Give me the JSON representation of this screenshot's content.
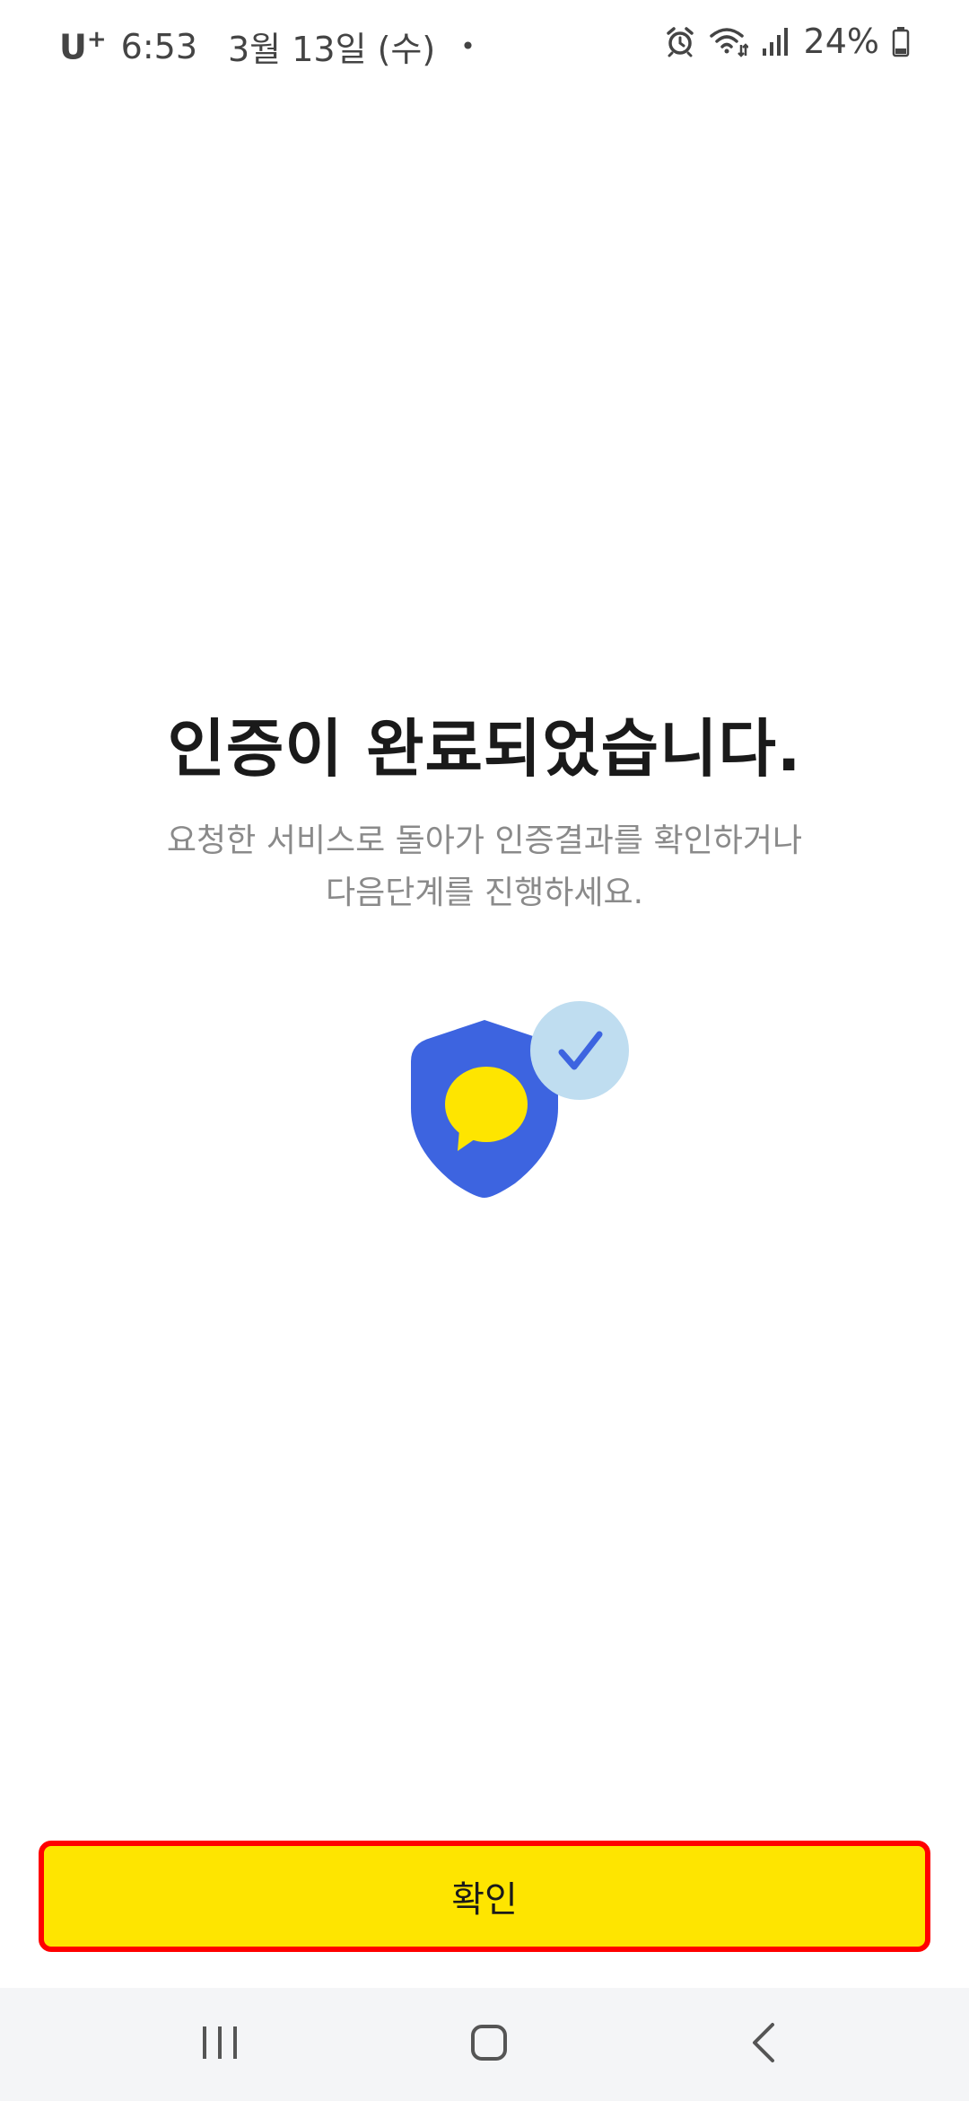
{
  "status_bar": {
    "carrier": "U",
    "carrier_sup": "+",
    "time": "6:53",
    "date": "3월 13일 (수)",
    "dot": "•",
    "battery": "24%",
    "icons": [
      "alarm-icon",
      "wifi-icon",
      "signal-icon",
      "battery-icon"
    ]
  },
  "main": {
    "title": "인증이 완료되었습니다.",
    "subtitle_line1": "요청한 서비스로 돌아가 인증결과를 확인하거나",
    "subtitle_line2": "다음단계를 진행하세요."
  },
  "illustration": {
    "icons": [
      "shield-icon",
      "chat-bubble-icon",
      "check-icon"
    ],
    "colors": {
      "shield": "#3D64E0",
      "bubble": "#FEE500",
      "check_circle": "#BFDDF0",
      "check": "#3D64E0"
    }
  },
  "confirm_button": {
    "label": "확인",
    "color": "#FEE500",
    "highlight_border": "#FF0000"
  },
  "nav_bar": {
    "icons": [
      "recent-apps-icon",
      "home-icon",
      "back-icon"
    ]
  }
}
